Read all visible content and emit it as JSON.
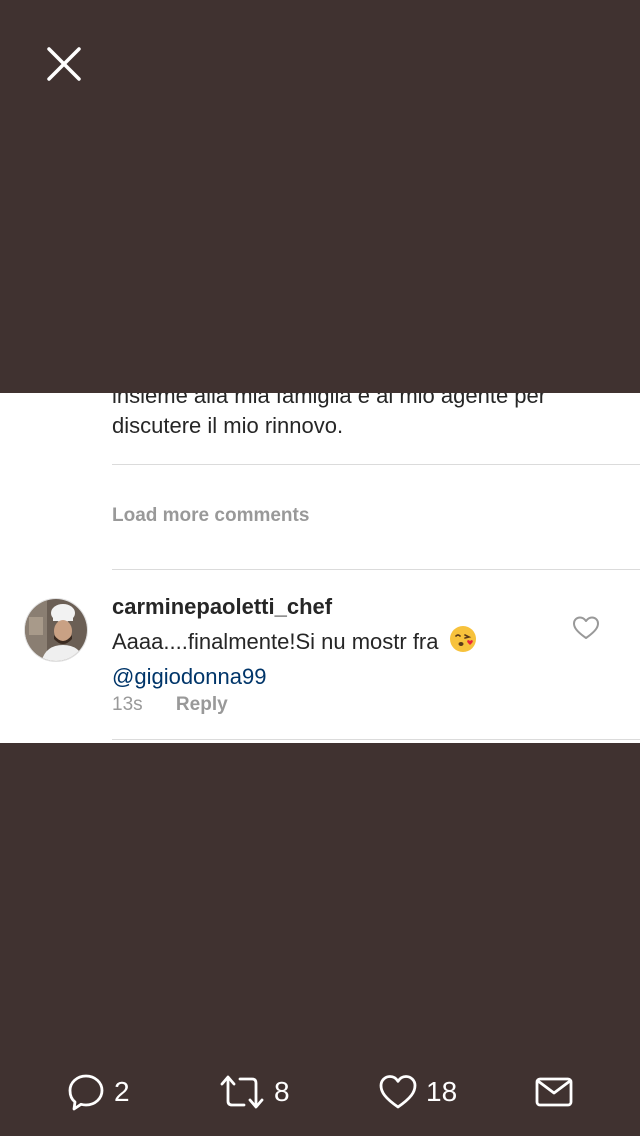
{
  "post": {
    "previous_comment_cut_line": "insieme alla mia famiglia e al mio agente per",
    "previous_comment_last_line": "discutere il mio rinnovo.",
    "load_more_label": "Load more comments",
    "comment": {
      "username": "carminepaoletti_chef",
      "text": "Aaaa....finalmente!Si nu mostr fra",
      "mention": "@gigiodonna99",
      "time": "13s",
      "reply_label": "Reply"
    }
  },
  "actions": {
    "replies": "2",
    "retweets": "8",
    "likes": "18"
  },
  "icons": {
    "close": "close-icon",
    "reply": "reply-icon",
    "retweet": "retweet-icon",
    "like": "heart-icon",
    "message": "envelope-icon",
    "emoji": "kissing-face-emoji"
  },
  "colors": {
    "background": "#403230",
    "mention": "#003569",
    "muted_text": "#999999"
  }
}
